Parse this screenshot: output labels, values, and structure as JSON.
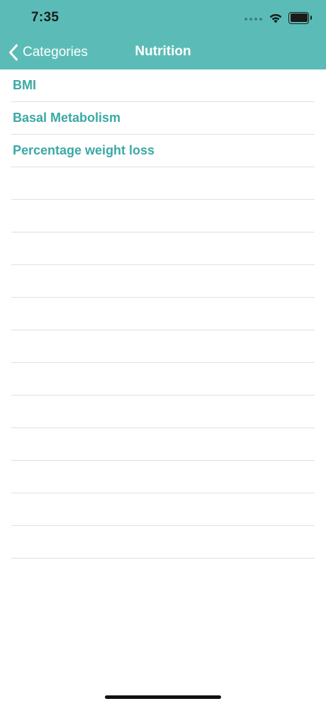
{
  "status_bar": {
    "time": "7:35"
  },
  "nav_bar": {
    "back_label": "Categories",
    "title": "Nutrition"
  },
  "list": {
    "items": [
      {
        "label": "BMI"
      },
      {
        "label": "Basal Metabolism"
      },
      {
        "label": "Percentage weight loss"
      },
      {
        "label": ""
      },
      {
        "label": ""
      },
      {
        "label": ""
      },
      {
        "label": ""
      },
      {
        "label": ""
      },
      {
        "label": ""
      },
      {
        "label": ""
      },
      {
        "label": ""
      },
      {
        "label": ""
      },
      {
        "label": ""
      },
      {
        "label": ""
      },
      {
        "label": ""
      }
    ]
  },
  "colors": {
    "nav_background": "#5bbcb7",
    "link_text": "#3aa9a5",
    "separator": "#e1e1e1"
  },
  "icons": {
    "back": "chevron-left-icon",
    "wifi": "wifi-icon",
    "battery": "battery-icon",
    "signal": "signal-dots-icon"
  }
}
